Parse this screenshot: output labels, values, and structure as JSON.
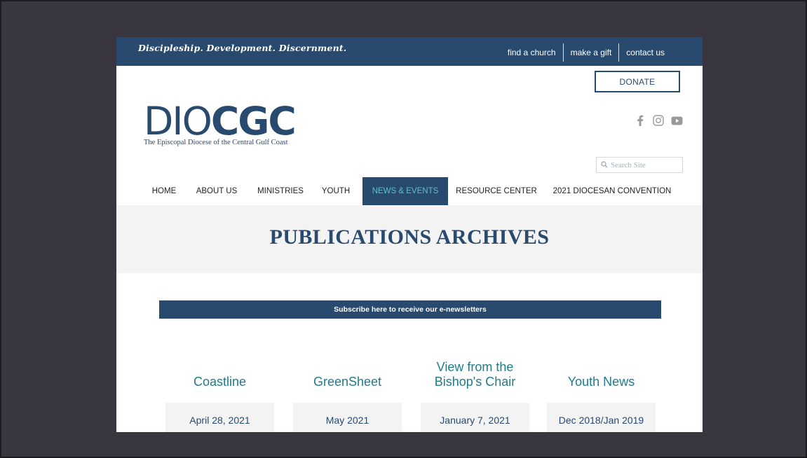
{
  "topbar": {
    "tagline": "Discipleship. Development. Discernment.",
    "links": [
      "find a church",
      "make a gift",
      "contact us"
    ]
  },
  "donate_label": "DONATE",
  "logo": {
    "thin": "DIO",
    "bold": "CGC",
    "subtitle": "The Episcopal Diocese of the Central Gulf Coast"
  },
  "social_icons": [
    "facebook-icon",
    "instagram-icon",
    "youtube-icon"
  ],
  "search": {
    "placeholder": "Search Site"
  },
  "nav": {
    "items": [
      "HOME",
      "ABOUT US",
      "MINISTRIES",
      "YOUTH",
      "NEWS & EVENTS",
      "RESOURCE CENTER",
      "2021 DIOCESAN CONVENTION"
    ],
    "active": "NEWS & EVENTS"
  },
  "hero": {
    "title": "PUBLICATIONS ARCHIVES"
  },
  "subscribe_label": "Subscribe here to receive our e-newsletters",
  "publications": [
    {
      "title_line1": "Coastline",
      "title_line2": "",
      "date": "April 28, 2021"
    },
    {
      "title_line1": "GreenSheet",
      "title_line2": "",
      "date": "May 2021"
    },
    {
      "title_line1": "View from the",
      "title_line2": "Bishop's Chair",
      "date": "January 7, 2021"
    },
    {
      "title_line1": "Youth News",
      "title_line2": "",
      "date": "Dec 2018/Jan 2019"
    }
  ],
  "colors": {
    "brand_navy": "#284a6e",
    "teal": "#1f7b8a",
    "active_nav_text": "#5cc1c8",
    "outer_background": "#39363f"
  }
}
